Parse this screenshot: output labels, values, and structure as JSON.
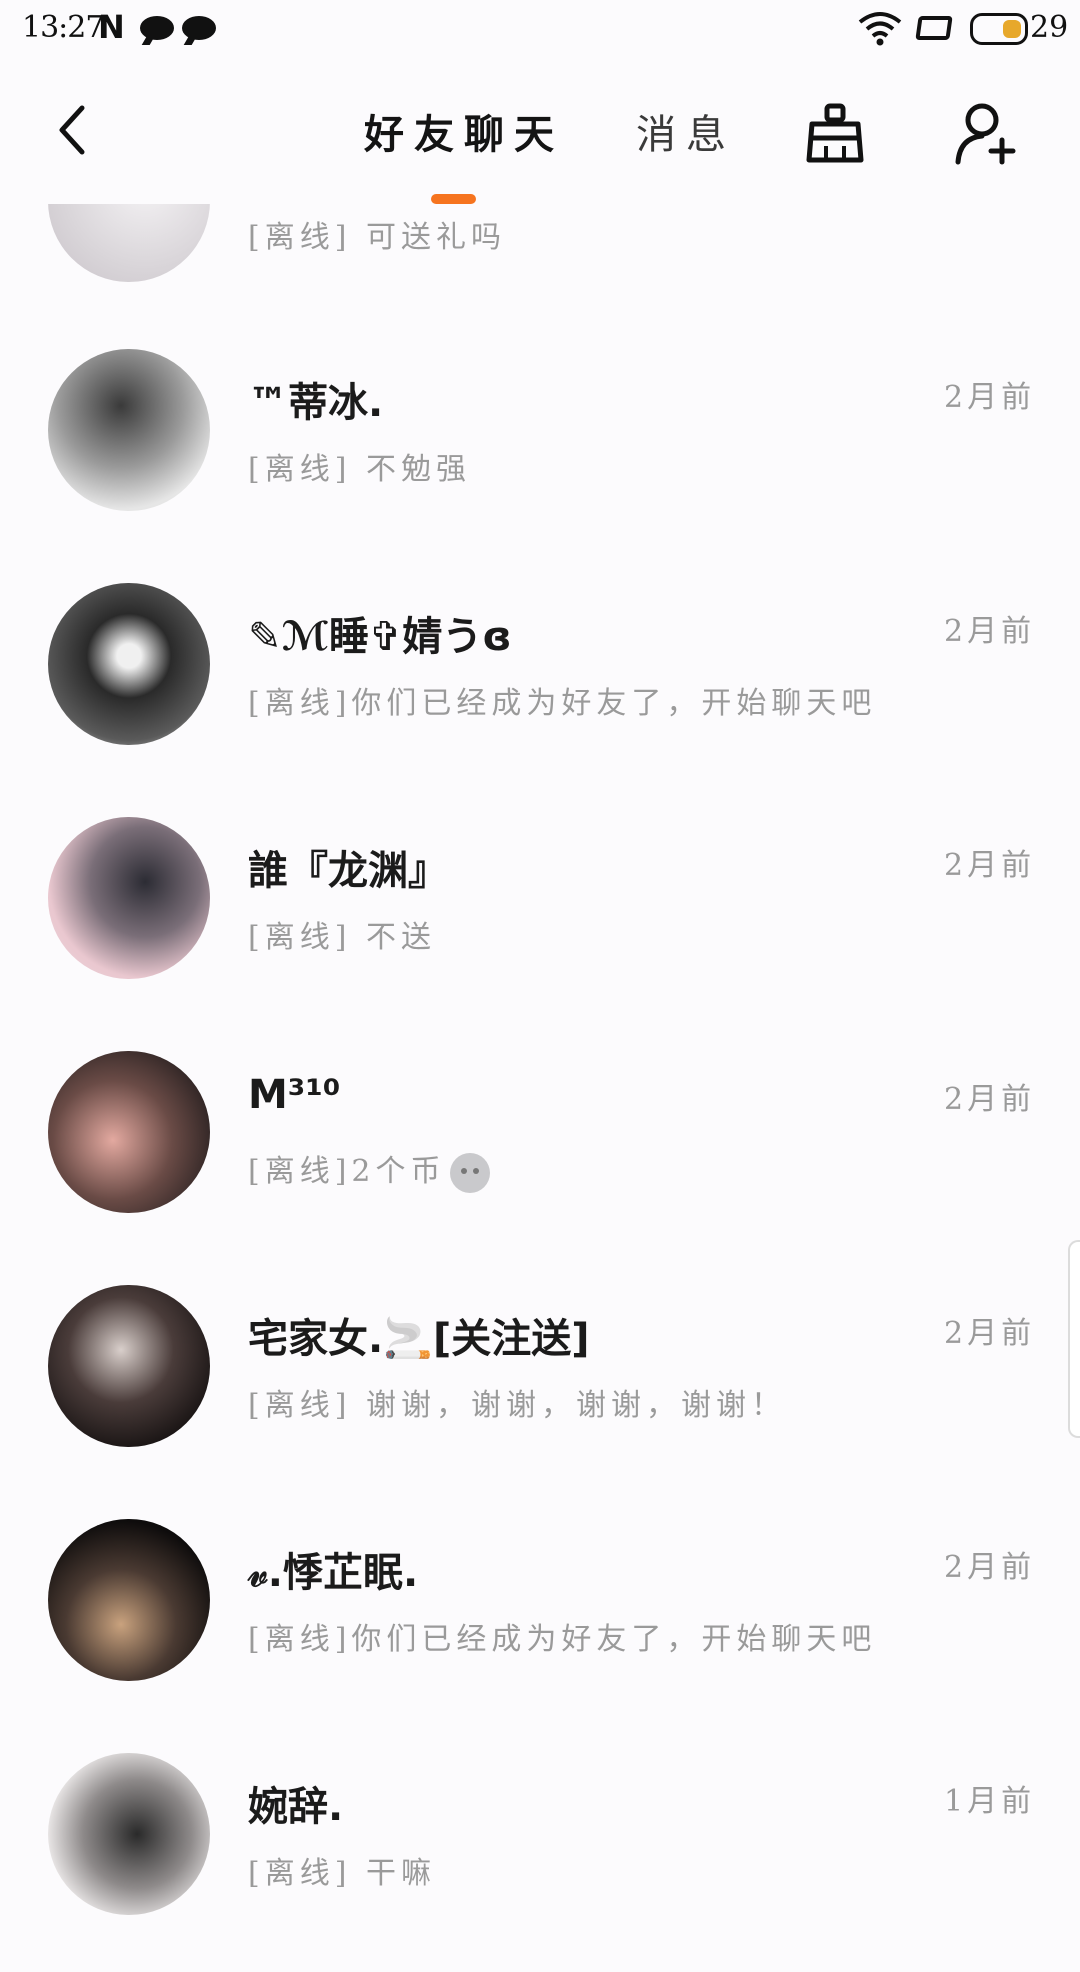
{
  "status": {
    "time": "13:27",
    "n_label": "N",
    "battery": "29"
  },
  "header": {
    "tab_friends": "好友聊天",
    "tab_messages": "消息"
  },
  "colors": {
    "accent": "#f6741f",
    "name": "#1b1b1b",
    "secondary": "#9a9a9a"
  },
  "conversations": [
    {
      "name": "",
      "message": "[离线] 可送礼吗",
      "time": ""
    },
    {
      "name": "™蒂冰.",
      "message": "[离线] 不勉强",
      "time": "2月前"
    },
    {
      "name": "✎ℳ睡✞婧うɞ",
      "message": "[离线]你们已经成为好友了，开始聊天吧",
      "time": "2月前"
    },
    {
      "name": "誰『龙渊』",
      "message": "[离线] 不送",
      "time": "2月前"
    },
    {
      "name": "M³¹⁰",
      "message": "[离线]2个币",
      "time": "2月前"
    },
    {
      "name": "宅家女.🚬[关注送]",
      "message": "[离线] 谢谢，谢谢，谢谢，谢谢！",
      "time": "2月前"
    },
    {
      "name": "𝓋.悸芷眠.",
      "message": "[离线]你们已经成为好友了，开始聊天吧",
      "time": "2月前"
    },
    {
      "name": "婉辞.",
      "message": "[离线] 干嘛",
      "time": "1月前"
    }
  ]
}
